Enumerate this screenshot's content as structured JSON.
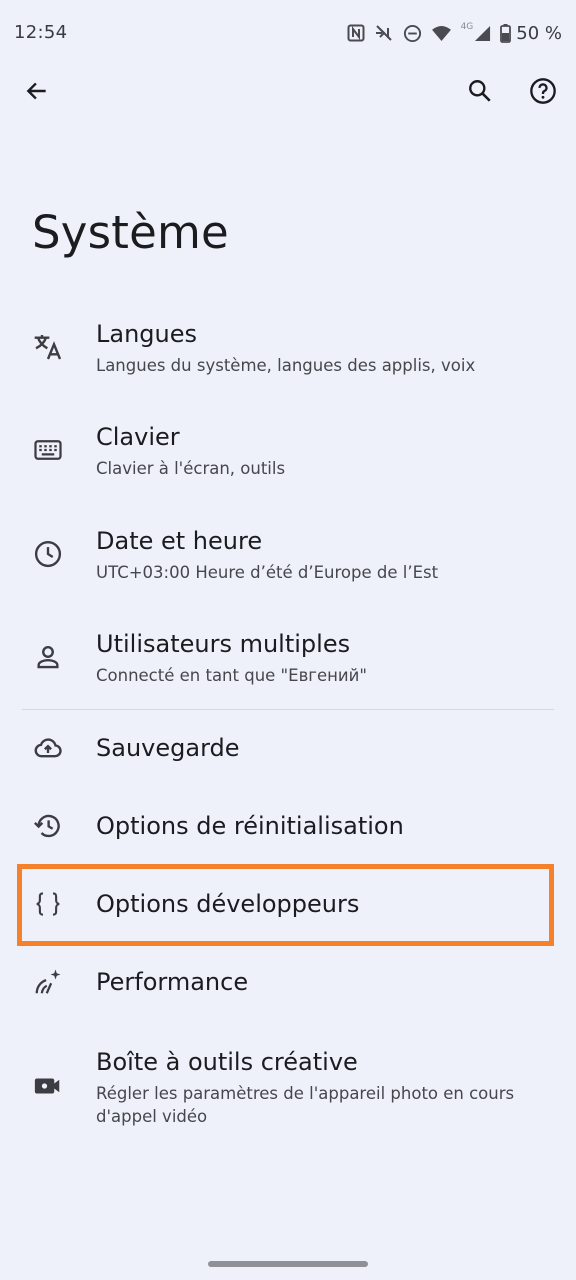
{
  "status_bar": {
    "time": "12:54",
    "network_type": "4G",
    "battery": "50 %"
  },
  "top_bar": {
    "back_icon": "arrow-back-icon",
    "search_icon": "search-icon",
    "help_icon": "help-icon"
  },
  "page": {
    "title": "Système"
  },
  "items": [
    {
      "title": "Langues",
      "subtitle": "Langues du système, langues des applis, voix",
      "icon": "translate-icon"
    },
    {
      "title": "Clavier",
      "subtitle": "Clavier à l'écran, outils",
      "icon": "keyboard-icon"
    },
    {
      "title": "Date et heure",
      "subtitle": "UTC+03:00 Heure d’été d’Europe de l’Est",
      "icon": "clock-icon"
    },
    {
      "title": "Utilisateurs multiples",
      "subtitle": "Connecté en tant que \"Евгений\"",
      "icon": "person-icon"
    },
    {
      "title": "Sauvegarde",
      "icon": "cloud-upload-icon"
    },
    {
      "title": "Options de réinitialisation",
      "icon": "history-icon"
    },
    {
      "title": "Options développeurs",
      "icon": "code-braces-icon"
    },
    {
      "title": "Performance",
      "icon": "performance-icon"
    },
    {
      "title": "Boîte à outils créative",
      "subtitle": "Régler les paramètres de l'appareil photo en cours d'appel vidéo",
      "icon": "video-camera-settings-icon"
    }
  ],
  "highlight_color": "#f5822a"
}
